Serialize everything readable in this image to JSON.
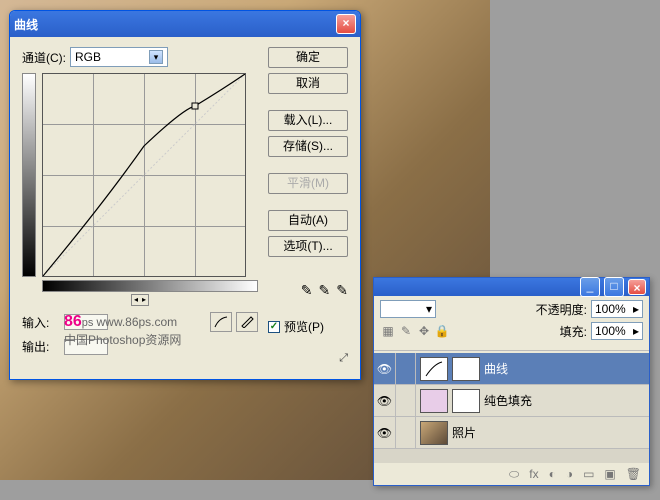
{
  "dialog": {
    "title": "曲线",
    "channel_label": "通道(C):",
    "channel_value": "RGB",
    "input_label": "输入:",
    "output_label": "输出:",
    "footer_line1": "86",
    "footer_url": "www.86ps.com",
    "footer_line2": "中国Photoshop资源网"
  },
  "buttons": {
    "ok": "确定",
    "cancel": "取消",
    "load": "载入(L)...",
    "save": "存储(S)...",
    "smooth": "平滑(M)",
    "auto": "自动(A)",
    "options": "选项(T)...",
    "preview": "预览(P)"
  },
  "layers": {
    "opacity_label": "不透明度:",
    "opacity_value": "100%",
    "fill_label": "填充:",
    "fill_value": "100%",
    "items": [
      {
        "name": "曲线",
        "selected": true,
        "visible": true,
        "thumb": "curve"
      },
      {
        "name": "纯色填充",
        "selected": false,
        "visible": true,
        "thumb": "pink"
      },
      {
        "name": "照片",
        "selected": false,
        "visible": true,
        "thumb": "photo"
      }
    ]
  },
  "chart_data": {
    "type": "line",
    "title": "RGB Curve",
    "xlabel": "输入",
    "ylabel": "输出",
    "xlim": [
      0,
      255
    ],
    "ylim": [
      0,
      255
    ],
    "points": [
      {
        "x": 0,
        "y": 0
      },
      {
        "x": 128,
        "y": 165
      },
      {
        "x": 191,
        "y": 214
      },
      {
        "x": 255,
        "y": 255
      }
    ]
  }
}
